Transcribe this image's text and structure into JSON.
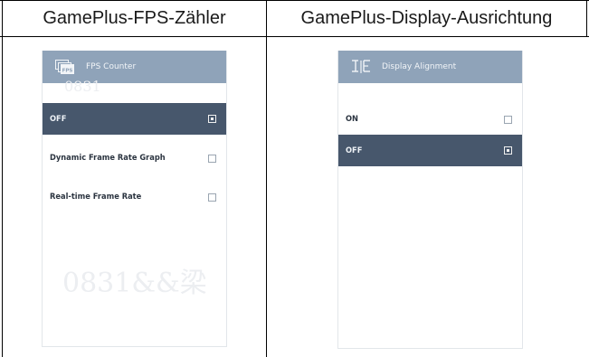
{
  "headers": {
    "left": "GamePlus-FPS-Zähler",
    "right": "GamePlus-Display-Ausrichtung"
  },
  "fps_panel": {
    "title": "FPS Counter",
    "icon": "fps-icon",
    "items": [
      {
        "label": "OFF",
        "selected": true,
        "checked": true
      },
      {
        "label": "Dynamic Frame Rate Graph",
        "selected": false,
        "checked": false
      },
      {
        "label": "Real-time Frame Rate",
        "selected": false,
        "checked": false
      }
    ],
    "watermark_top": "0831",
    "watermark_bottom": "0831&&梁"
  },
  "alignment_panel": {
    "title": "Display Alignment",
    "icon": "display-alignment-icon",
    "items": [
      {
        "label": "ON",
        "selected": false,
        "checked": false
      },
      {
        "label": "OFF",
        "selected": true,
        "checked": true
      }
    ]
  },
  "colors": {
    "panel_header": "#8fa3b9",
    "selected_row": "#47576c"
  }
}
